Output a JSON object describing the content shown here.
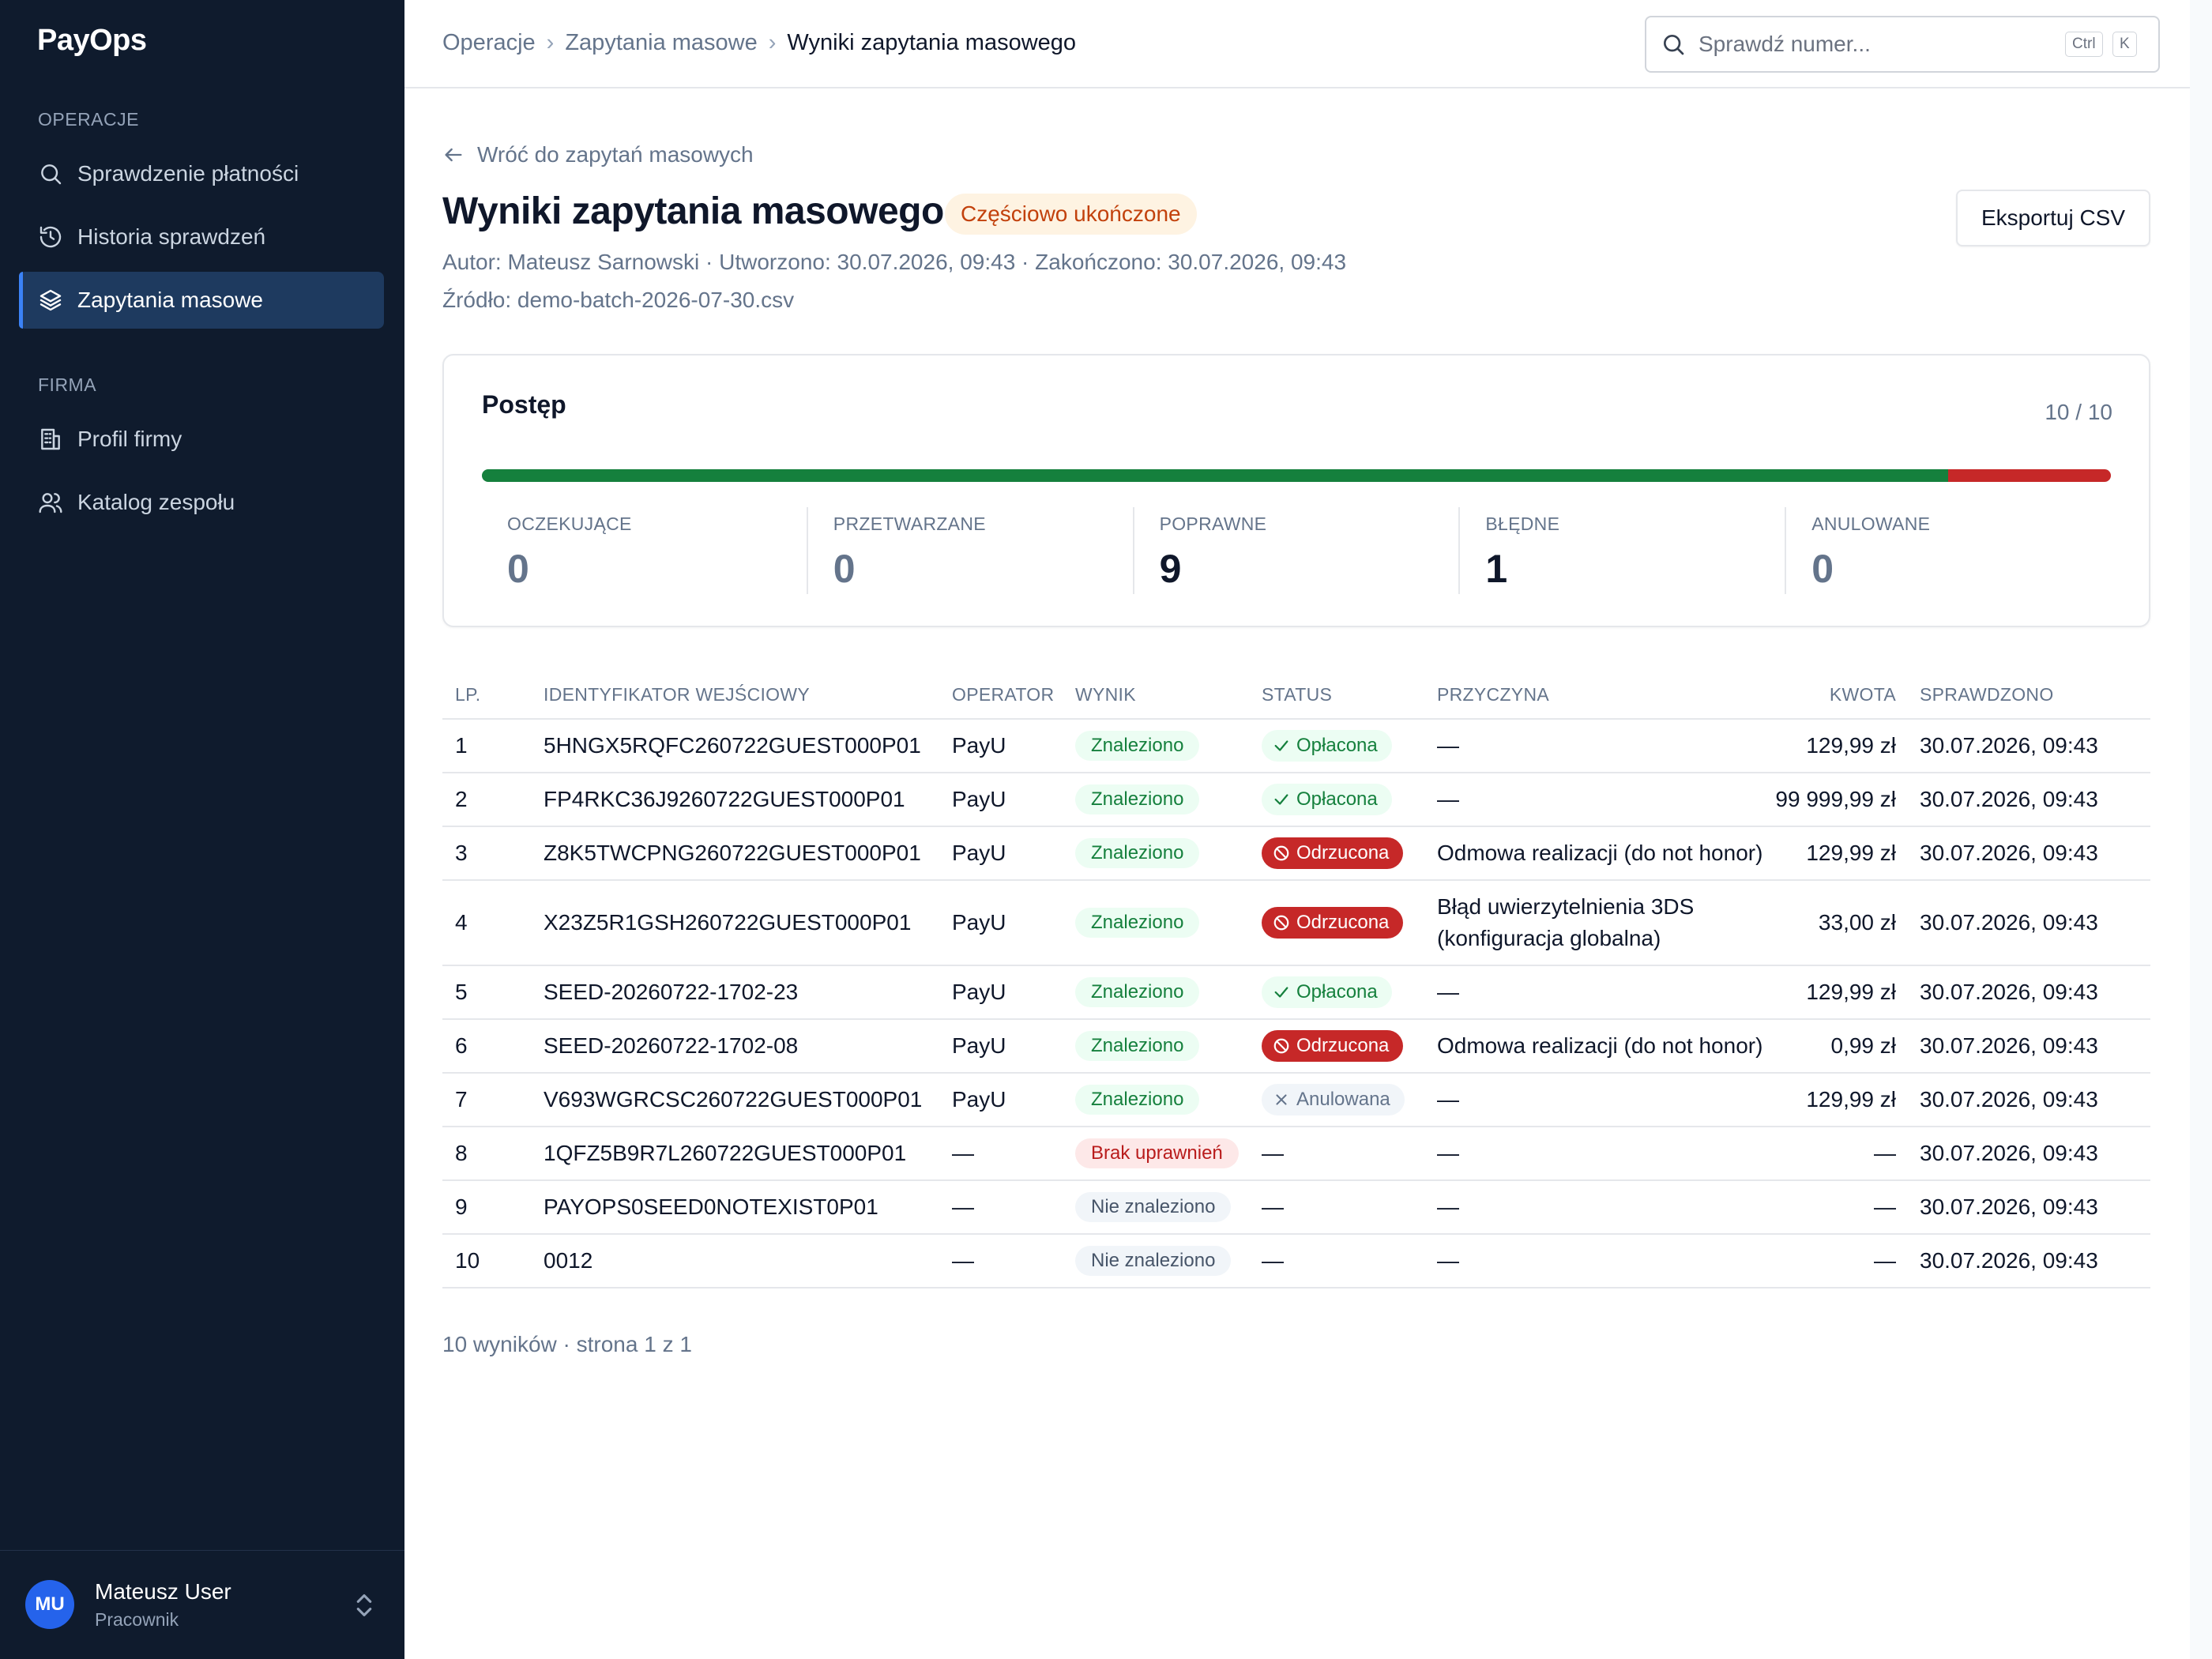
{
  "app": {
    "brand": "PayOps"
  },
  "sidebar": {
    "sections": [
      {
        "label": "OPERACJE"
      },
      {
        "label": "FIRMA"
      }
    ],
    "items": [
      {
        "label": "Sprawdzenie płatności",
        "icon": "search-icon"
      },
      {
        "label": "Historia sprawdzeń",
        "icon": "history-icon"
      },
      {
        "label": "Zapytania masowe",
        "icon": "layers-icon",
        "active": true
      },
      {
        "label": "Profil firmy",
        "icon": "building-icon"
      },
      {
        "label": "Katalog zespołu",
        "icon": "users-icon"
      }
    ],
    "user": {
      "initials": "MU",
      "name": "Mateusz User",
      "role": "Pracownik"
    }
  },
  "header": {
    "breadcrumb": [
      "Operacje",
      "Zapytania masowe",
      "Wyniki zapytania masowego"
    ],
    "search": {
      "placeholder": "Sprawdź numer...",
      "shortcut_mod": "Ctrl",
      "shortcut_key": "K"
    }
  },
  "page": {
    "back_label": "Wróć do zapytań masowych",
    "title": "Wyniki zapytania masowego",
    "status": "Częściowo ukończone",
    "export_label": "Eksportuj CSV",
    "meta_line1": "Autor: Mateusz Sarnowski · Utworzono: 30.07.2026, 09:43 · Zakończono: 30.07.2026, 09:43",
    "meta_line2": "Źródło: demo-batch-2026-07-30.csv"
  },
  "progress": {
    "title": "Postęp",
    "count": "10 / 10",
    "ok_fraction": 0.9,
    "error_fraction": 0.1,
    "colors": {
      "ok": "#15803d",
      "error": "#c62828"
    },
    "stats": [
      {
        "label": "OCZEKUJĄCE",
        "value": "0"
      },
      {
        "label": "PRZETWARZANE",
        "value": "0"
      },
      {
        "label": "POPRAWNE",
        "value": "9"
      },
      {
        "label": "BŁĘDNE",
        "value": "1"
      },
      {
        "label": "ANULOWANE",
        "value": "0"
      }
    ]
  },
  "table": {
    "columns": [
      "LP.",
      "IDENTYFIKATOR WEJŚCIOWY",
      "OPERATOR",
      "WYNIK",
      "STATUS",
      "PRZYCZYNA",
      "KWOTA",
      "SPRAWDZONO"
    ],
    "rows": [
      {
        "lp": "1",
        "id": "5HNGX5RQFC260722GUEST000P01",
        "operator": "PayU",
        "result": "Znaleziono",
        "result_type": "found",
        "status": "Opłacona",
        "status_type": "paid",
        "reason": "—",
        "amount": "129,99 zł",
        "checked": "30.07.2026, 09:43"
      },
      {
        "lp": "2",
        "id": "FP4RKC36J9260722GUEST000P01",
        "operator": "PayU",
        "result": "Znaleziono",
        "result_type": "found",
        "status": "Opłacona",
        "status_type": "paid",
        "reason": "—",
        "amount": "99 999,99 zł",
        "checked": "30.07.2026, 09:43"
      },
      {
        "lp": "3",
        "id": "Z8K5TWCPNG260722GUEST000P01",
        "operator": "PayU",
        "result": "Znaleziono",
        "result_type": "found",
        "status": "Odrzucona",
        "status_type": "rejected",
        "reason": "Odmowa realizacji (do not honor)",
        "amount": "129,99 zł",
        "checked": "30.07.2026, 09:43"
      },
      {
        "lp": "4",
        "id": "X23Z5R1GSH260722GUEST000P01",
        "operator": "PayU",
        "result": "Znaleziono",
        "result_type": "found",
        "status": "Odrzucona",
        "status_type": "rejected",
        "reason": "Błąd uwierzytelnienia 3DS",
        "reason_line2": "(konfiguracja globalna)",
        "amount": "33,00 zł",
        "checked": "30.07.2026, 09:43"
      },
      {
        "lp": "5",
        "id": "SEED-20260722-1702-23",
        "operator": "PayU",
        "result": "Znaleziono",
        "result_type": "found",
        "status": "Opłacona",
        "status_type": "paid",
        "reason": "—",
        "amount": "129,99 zł",
        "checked": "30.07.2026, 09:43"
      },
      {
        "lp": "6",
        "id": "SEED-20260722-1702-08",
        "operator": "PayU",
        "result": "Znaleziono",
        "result_type": "found",
        "status": "Odrzucona",
        "status_type": "rejected",
        "reason": "Odmowa realizacji (do not honor)",
        "amount": "0,99 zł",
        "checked": "30.07.2026, 09:43"
      },
      {
        "lp": "7",
        "id": "V693WGRCSC260722GUEST000P01",
        "operator": "PayU",
        "result": "Znaleziono",
        "result_type": "found",
        "status": "Anulowana",
        "status_type": "cancelled",
        "reason": "—",
        "amount": "129,99 zł",
        "checked": "30.07.2026, 09:43"
      },
      {
        "lp": "8",
        "id": "1QFZ5B9R7L260722GUEST000P01",
        "operator": "—",
        "result": "Brak uprawnień",
        "result_type": "noperm",
        "status": "—",
        "status_type": "none",
        "reason": "—",
        "amount": "—",
        "checked": "30.07.2026, 09:43"
      },
      {
        "lp": "9",
        "id": "PAYOPS0SEED0NOTEXIST0P01",
        "operator": "—",
        "result": "Nie znaleziono",
        "result_type": "notfound",
        "status": "—",
        "status_type": "none",
        "reason": "—",
        "amount": "—",
        "checked": "30.07.2026, 09:43"
      },
      {
        "lp": "10",
        "id": "0012",
        "operator": "—",
        "result": "Nie znaleziono",
        "result_type": "notfound",
        "status": "—",
        "status_type": "none",
        "reason": "—",
        "amount": "—",
        "checked": "30.07.2026, 09:43"
      }
    ],
    "footer": "10 wyników · strona 1 z 1"
  }
}
